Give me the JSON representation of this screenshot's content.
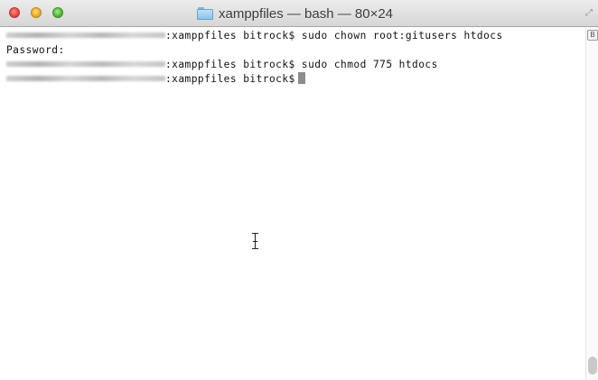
{
  "window": {
    "title": "xamppfiles — bash — 80×24",
    "resize_glyph": "⤢"
  },
  "terminal": {
    "lines": [
      {
        "prompt_suffix": ":xamppfiles bitrock$",
        "command": " sudo chown root:gitusers htdocs"
      },
      {
        "text": "Password:"
      },
      {
        "prompt_suffix": ":xamppfiles bitrock$",
        "command": " sudo chmod 775 htdocs"
      },
      {
        "prompt_suffix": ":xamppfiles bitrock$",
        "command": ""
      }
    ]
  },
  "scrollbar": {
    "marker_glyph": "B"
  },
  "colors": {
    "background": "#ffffff",
    "text": "#111111",
    "cursor": "#8c8c8c",
    "titlebar_top": "#ececec",
    "titlebar_bottom": "#d6d6d6"
  },
  "icons": {
    "title_icon": "folder-icon",
    "pointer": "ibeam-cursor-icon"
  }
}
